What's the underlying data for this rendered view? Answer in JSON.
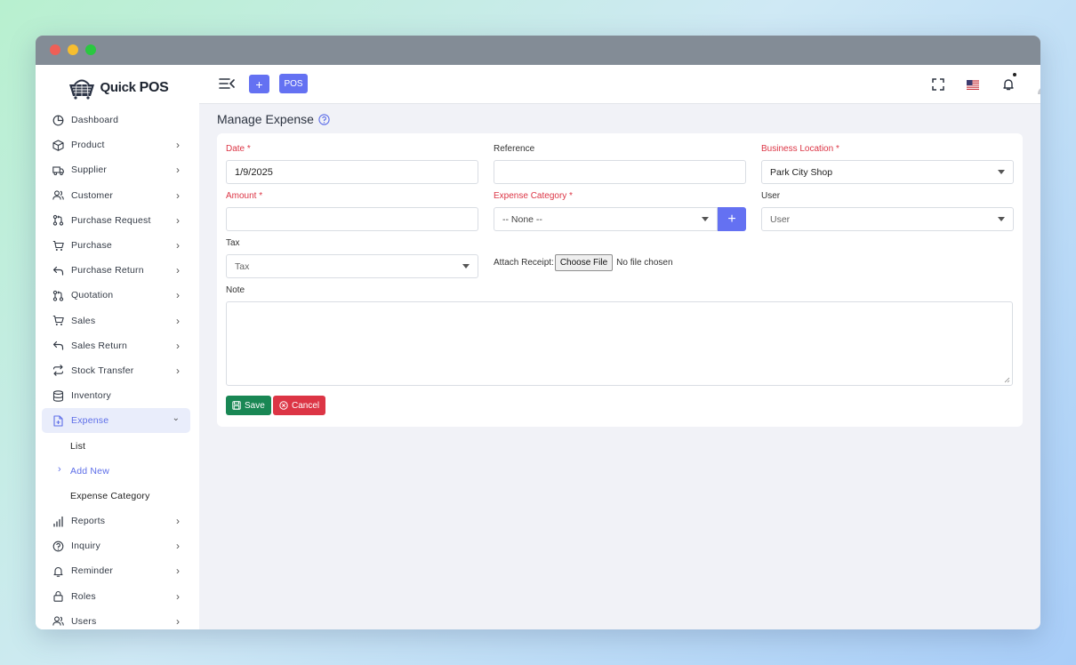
{
  "app": {
    "brand": "Quick",
    "brand_bold": "POS"
  },
  "sidebar": {
    "items": [
      {
        "label": "Dashboard",
        "icon": "dashboard-icon",
        "chevron": false
      },
      {
        "label": "Product",
        "icon": "box-icon",
        "chevron": true
      },
      {
        "label": "Supplier",
        "icon": "truck-icon",
        "chevron": true
      },
      {
        "label": "Customer",
        "icon": "users-icon",
        "chevron": true
      },
      {
        "label": "Purchase Request",
        "icon": "pull-request-icon",
        "chevron": true
      },
      {
        "label": "Purchase",
        "icon": "cart-icon",
        "chevron": true
      },
      {
        "label": "Purchase Return",
        "icon": "return-arrow-icon",
        "chevron": true
      },
      {
        "label": "Quotation",
        "icon": "pull-request-icon",
        "chevron": true
      },
      {
        "label": "Sales",
        "icon": "cart-icon",
        "chevron": true
      },
      {
        "label": "Sales Return",
        "icon": "return-arrow-icon",
        "chevron": true
      },
      {
        "label": "Stock Transfer",
        "icon": "transfer-icon",
        "chevron": true
      },
      {
        "label": "Inventory",
        "icon": "database-icon",
        "chevron": false
      }
    ],
    "expense": {
      "label": "Expense",
      "icon": "file-plus-icon",
      "sub": [
        "List",
        "Add New",
        "Expense Category"
      ]
    },
    "items_after": [
      {
        "label": "Reports",
        "icon": "bar-chart-icon",
        "chevron": true
      },
      {
        "label": "Inquiry",
        "icon": "question-circle-icon",
        "chevron": true
      },
      {
        "label": "Reminder",
        "icon": "bell-icon",
        "chevron": true
      },
      {
        "label": "Roles",
        "icon": "lock-icon",
        "chevron": true
      },
      {
        "label": "Users",
        "icon": "users-icon",
        "chevron": true
      }
    ]
  },
  "topbar": {
    "add_label": "+",
    "pos_label": "POS"
  },
  "page": {
    "title": "Manage Expense"
  },
  "form": {
    "date": {
      "label": "Date *",
      "value": "1/9/2025"
    },
    "reference": {
      "label": "Reference",
      "value": ""
    },
    "business_location": {
      "label": "Business Location *",
      "value": "Park City Shop"
    },
    "amount": {
      "label": "Amount *",
      "value": ""
    },
    "expense_category": {
      "label": "Expense Category *",
      "value": "-- None --",
      "add_label": "+"
    },
    "user": {
      "label": "User",
      "placeholder": "User"
    },
    "tax": {
      "label": "Tax",
      "placeholder": "Tax"
    },
    "attach": {
      "label": "Attach Receipt:",
      "button": "Choose File",
      "status": "No file chosen"
    },
    "note": {
      "label": "Note",
      "value": ""
    },
    "save_label": "Save",
    "cancel_label": "Cancel"
  },
  "colors": {
    "primary": "#6471f2",
    "save": "#198754",
    "cancel": "#dc3545",
    "required": "#dc3545"
  }
}
